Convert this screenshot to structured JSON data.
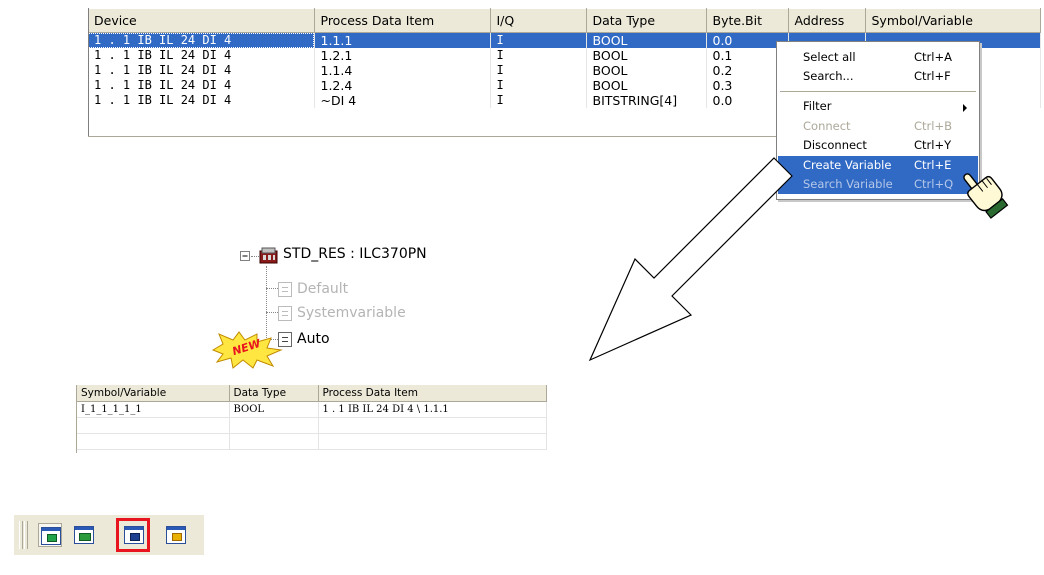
{
  "top_table": {
    "columns": [
      "Device",
      "Process Data Item",
      "I/Q",
      "Data Type",
      "Byte.Bit",
      "Address",
      "Symbol/Variable"
    ],
    "rows": [
      [
        "1 . 1 IB IL 24 DI 4",
        "1.1.1",
        "I",
        "BOOL",
        "0.0",
        "",
        ""
      ],
      [
        "1 . 1 IB IL 24 DI 4",
        "1.2.1",
        "I",
        "BOOL",
        "0.1",
        "",
        ""
      ],
      [
        "1 . 1 IB IL 24 DI 4",
        "1.1.4",
        "I",
        "BOOL",
        "0.2",
        "",
        ""
      ],
      [
        "1 . 1 IB IL 24 DI 4",
        "1.2.4",
        "I",
        "BOOL",
        "0.3",
        "",
        ""
      ],
      [
        "1 . 1 IB IL 24 DI 4",
        "~DI 4",
        "I",
        "BITSTRING[4]",
        "0.0",
        "",
        ""
      ]
    ],
    "selected_row": 0
  },
  "context_menu": {
    "items": [
      {
        "label": "Select all",
        "shortcut": "Ctrl+A",
        "enabled": true
      },
      {
        "label": "Search...",
        "shortcut": "Ctrl+F",
        "enabled": true
      },
      {
        "label": "Filter",
        "shortcut": "",
        "enabled": true,
        "submenu": true
      },
      {
        "label": "Connect",
        "shortcut": "Ctrl+B",
        "enabled": false
      },
      {
        "label": "Disconnect",
        "shortcut": "Ctrl+Y",
        "enabled": true
      },
      {
        "label": "Create Variable",
        "shortcut": "Ctrl+E",
        "enabled": true,
        "highlighted": true
      },
      {
        "label": "Search Variable",
        "shortcut": "Ctrl+Q",
        "enabled": false
      }
    ]
  },
  "tree": {
    "root": "STD_RES : ILC370PN",
    "children": [
      {
        "label": "Default",
        "enabled": false
      },
      {
        "label": "Systemvariable",
        "enabled": false
      },
      {
        "label": "Auto",
        "enabled": true
      }
    ],
    "badge": "NEW"
  },
  "bottom_table": {
    "columns": [
      "Symbol/Variable",
      "Data Type",
      "Process Data Item"
    ],
    "rows": [
      [
        "I_1_1_1_1_1",
        "BOOL",
        "1 . 1 IB IL 24 DI 4 \\ 1.1.1"
      ],
      [
        "",
        "",
        ""
      ],
      [
        "",
        "",
        ""
      ]
    ]
  },
  "toolbar": {
    "buttons": [
      {
        "icon": "device-view-icon",
        "inner_color": "#22a34a"
      },
      {
        "icon": "network-view-icon",
        "inner_color": "#2a9a3a"
      },
      {
        "icon": "process-data-icon",
        "inner_color": "#1c3f8f",
        "highlighted": true
      },
      {
        "icon": "unknown-device-icon",
        "inner_color": "#e8b000"
      }
    ]
  },
  "colors": {
    "selection": "#316ac5",
    "highlight_box": "#e8141e",
    "badge_fill": "#ffe640",
    "badge_text": "#e8141e"
  }
}
